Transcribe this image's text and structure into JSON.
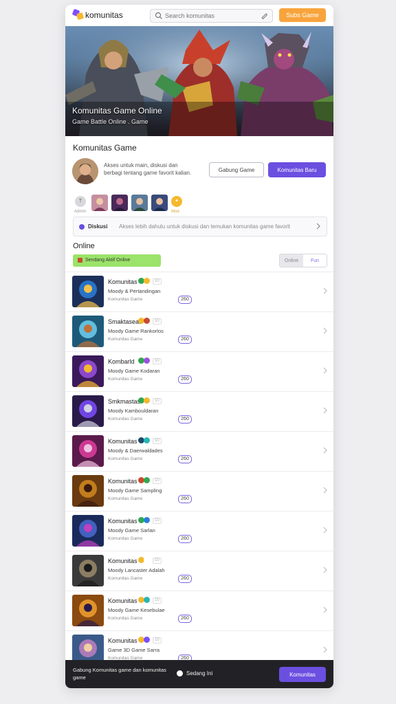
{
  "header": {
    "logo_text": "komunitas",
    "search_placeholder": "Search komunitas",
    "top_button": "Subs Game"
  },
  "hero": {
    "title": "Komunitas Game Online",
    "subtitle": "Game Battle  Online . Game"
  },
  "community": {
    "title": "Komunitas Game",
    "description": "Akses untuk main, diskusi dan berbagi tentang game favorit kalian.",
    "outline_button": "Gabung Game",
    "primary_button": "Komunitas Baru"
  },
  "members": {
    "first_initial": "T",
    "first_label": "Admin",
    "last_label": "Mod",
    "count": 6
  },
  "notice": {
    "title": "Diskusi",
    "text": "Akses lebih dahulu untuk diskusi dan temukan komunitas game favorit"
  },
  "online": {
    "title": "Online",
    "badge": "Sendang Aktif Online",
    "segment_left": "Online",
    "segment_right": "Fun"
  },
  "games": [
    {
      "title": "Komunitas",
      "line1": "Moody & Pertandingan",
      "line2": "Komunitas Game",
      "count": "260",
      "c1": "#2fa84f",
      "c2": "#f5b82e",
      "tag": "10"
    },
    {
      "title": "Smaktaseat",
      "line1": "Moody Game Rankorlos",
      "line2": "Komunitas Game",
      "count": "260",
      "c1": "#f5b82e",
      "c2": "#c94b2c",
      "tag": "10"
    },
    {
      "title": "Kombarld",
      "line1": "Moody Game Kodaran",
      "line2": "Komunitas Game",
      "count": "260",
      "c1": "#2fa84f",
      "c2": "#9b51e0",
      "tag": "10"
    },
    {
      "title": "Smkmastas",
      "line1": "Moody Kambouldaran",
      "line2": "Komunitas Game",
      "count": "260",
      "c1": "#2fa84f",
      "c2": "#f5b82e",
      "tag": "10"
    },
    {
      "title": "Komunitas",
      "line1": "Moody & Daerwaldades",
      "line2": "Komunitas Game",
      "count": "260",
      "c1": "#1d4c6e",
      "c2": "#28b5b5",
      "tag": "10"
    },
    {
      "title": "Komunitas",
      "line1": "Moody Game Sampling",
      "line2": "Komunitas Game",
      "count": "260",
      "c1": "#c94b2c",
      "c2": "#2fa84f",
      "tag": "10"
    },
    {
      "title": "Komunitas",
      "line1": "Moody Game Sarlan",
      "line2": "Komunitas Game",
      "count": "260",
      "c1": "#2fa84f",
      "c2": "#2a7fd9",
      "tag": "10"
    },
    {
      "title": "Komunitas",
      "line1": "Moody Lancaster Adalah",
      "line2": "Komunitas Game",
      "count": "260",
      "c1": "#f5b82e",
      "c2": "#ffffff",
      "tag": "10"
    },
    {
      "title": "Komunitas",
      "line1": "Moody Game Kesebulae",
      "line2": "Komunitas Game",
      "count": "260",
      "c1": "#f5b82e",
      "c2": "#28b5b5",
      "tag": "10"
    },
    {
      "title": "Komunitas",
      "line1": "Game 3D Game Sarra",
      "line2": "Komunitas Game",
      "count": "260",
      "c1": "#f5b82e",
      "c2": "#7c4dff",
      "tag": "10"
    }
  ],
  "bottom": {
    "text": "Gabung Komunitas game dan komunitas game",
    "status": "Sedang Ini",
    "button": "Komunitas"
  },
  "colors": {
    "accent": "#6b4fe0",
    "orange": "#f8a43c",
    "online_green": "#9be36a"
  }
}
